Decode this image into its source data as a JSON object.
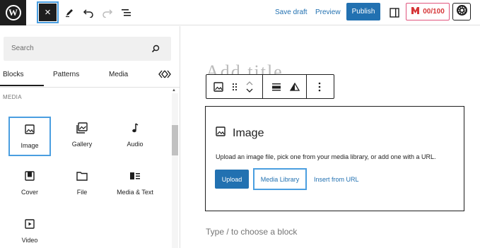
{
  "topbar": {
    "logo_letter": "W",
    "close_glyph": "×",
    "save_draft": "Save draft",
    "preview": "Preview",
    "publish": "Publish",
    "score": "00/100",
    "icons": [
      "wordpress-logo-icon",
      "close-icon",
      "pencil-icon",
      "undo-icon",
      "redo-icon",
      "list-view-icon",
      "sidebar-toggle-icon",
      "seo-score-icon",
      "gear-icon"
    ]
  },
  "sidebar": {
    "search_placeholder": "Search",
    "tabs": [
      "Blocks",
      "Patterns",
      "Media"
    ],
    "active_tab": "Blocks",
    "category": "MEDIA",
    "blocks": [
      {
        "label": "Image",
        "icon": "image-icon",
        "selected": true
      },
      {
        "label": "Gallery",
        "icon": "gallery-icon",
        "selected": false
      },
      {
        "label": "Audio",
        "icon": "audio-icon",
        "selected": false
      },
      {
        "label": "Cover",
        "icon": "cover-icon",
        "selected": false
      },
      {
        "label": "File",
        "icon": "file-icon",
        "selected": false
      },
      {
        "label": "Media & Text",
        "icon": "media-text-icon",
        "selected": false
      },
      {
        "label": "Video",
        "icon": "video-icon",
        "selected": false
      }
    ]
  },
  "editor": {
    "ghost_title": "Add title",
    "image_block": {
      "title": "Image",
      "instructions": "Upload an image file, pick one from your media library, or add one with a URL.",
      "upload": "Upload",
      "media_library": "Media Library",
      "insert_url": "Insert from URL"
    },
    "type_prompt": "Type / to choose a block"
  },
  "colors": {
    "accent": "#2271b1",
    "highlight": "#4a9ee0",
    "dark": "#1e1e1e",
    "score": "#d63638"
  }
}
